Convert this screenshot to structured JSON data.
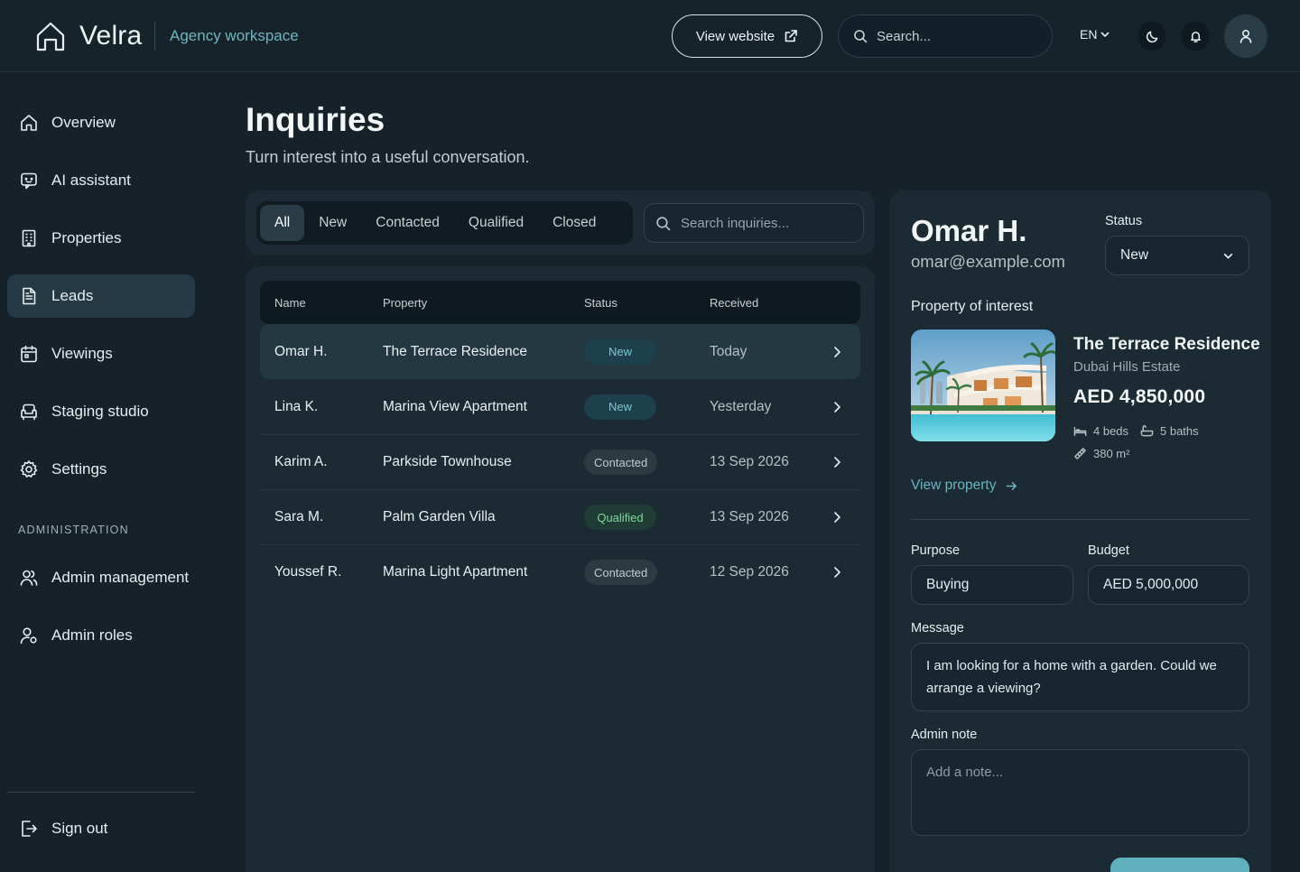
{
  "app": {
    "brand": "Velra",
    "workspace": "Agency workspace",
    "view_website": "View website",
    "search_placeholder": "Search...",
    "language": "EN"
  },
  "sidebar": {
    "items": [
      {
        "label": "Overview",
        "icon": "home-icon"
      },
      {
        "label": "AI assistant",
        "icon": "chat-bot-icon"
      },
      {
        "label": "Properties",
        "icon": "building-icon"
      },
      {
        "label": "Leads",
        "icon": "document-icon",
        "active": true
      },
      {
        "label": "Viewings",
        "icon": "calendar-icon"
      },
      {
        "label": "Staging studio",
        "icon": "sofa-icon"
      },
      {
        "label": "Settings",
        "icon": "gear-icon"
      }
    ],
    "section_title": "ADMINISTRATION",
    "admin_items": [
      {
        "label": "Admin management",
        "icon": "users-icon"
      },
      {
        "label": "Admin roles",
        "icon": "user-role-icon"
      }
    ],
    "sign_out": "Sign out"
  },
  "page": {
    "title": "Inquiries",
    "subtitle": "Turn interest into a useful conversation."
  },
  "filters": {
    "tabs": [
      "All",
      "New",
      "Contacted",
      "Qualified",
      "Closed"
    ],
    "active_tab": "All",
    "search_placeholder": "Search inquiries..."
  },
  "table": {
    "columns": [
      "Name",
      "Property",
      "Status",
      "Received"
    ],
    "rows": [
      {
        "name": "Omar H.",
        "property": "The Terrace Residence",
        "status": "New",
        "received": "Today"
      },
      {
        "name": "Lina K.",
        "property": "Marina View Apartment",
        "status": "New",
        "received": "Yesterday"
      },
      {
        "name": "Karim A.",
        "property": "Parkside Townhouse",
        "status": "Contacted",
        "received": "13 Sep 2026"
      },
      {
        "name": "Sara M.",
        "property": "Palm Garden Villa",
        "status": "Qualified",
        "received": "13 Sep 2026"
      },
      {
        "name": "Youssef R.",
        "property": "Marina Light Apartment",
        "status": "Contacted",
        "received": "12 Sep 2026"
      }
    ]
  },
  "detail": {
    "name": "Omar H.",
    "email": "omar@example.com",
    "status_label": "Status",
    "status_value": "New",
    "poi_label": "Property of interest",
    "property": {
      "title": "The Terrace Residence",
      "location": "Dubai Hills Estate",
      "price": "AED 4,850,000",
      "beds": "4 beds",
      "baths": "5 baths",
      "area": "380 m²",
      "view_link": "View property"
    },
    "purpose_label": "Purpose",
    "purpose_value": "Buying",
    "budget_label": "Budget",
    "budget_value": "AED 5,000,000",
    "message_label": "Message",
    "message_value": "I am looking for a home with a garden. Could we arrange a viewing?",
    "note_label": "Admin note",
    "note_placeholder": "Add a note..."
  },
  "colors": {
    "background": "#162129",
    "card": "#1c2b33",
    "accent": "#69b4c0",
    "status_new": "#7ec7d2",
    "status_qualified": "#7fd59c"
  }
}
